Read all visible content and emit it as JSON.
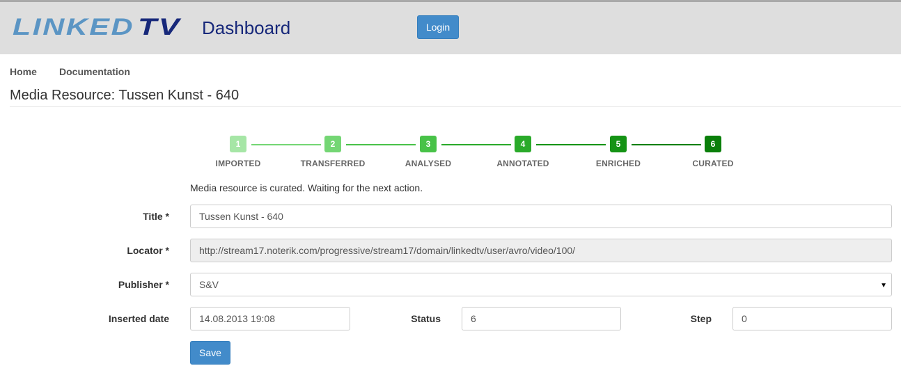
{
  "header": {
    "logo_text": "LINKEDTV",
    "title": "Dashboard",
    "login_label": "Login"
  },
  "nav": {
    "home": "Home",
    "documentation": "Documentation"
  },
  "page": {
    "title": "Media Resource: Tussen Kunst - 640"
  },
  "workflow": {
    "steps": [
      {
        "number": "1",
        "label": "IMPORTED",
        "color": "#a6e6a6"
      },
      {
        "number": "2",
        "label": "TRANSFERRED",
        "color": "#74d674"
      },
      {
        "number": "3",
        "label": "ANALYSED",
        "color": "#48c248"
      },
      {
        "number": "4",
        "label": "ANNOTATED",
        "color": "#2aaa2a"
      },
      {
        "number": "5",
        "label": "ENRICHED",
        "color": "#159315"
      },
      {
        "number": "6",
        "label": "CURATED",
        "color": "#0a7f0a"
      }
    ],
    "current_step": 6,
    "status_message": "Media resource is curated. Waiting for the next action."
  },
  "form": {
    "title_label": "Title *",
    "title_value": "Tussen Kunst - 640",
    "locator_label": "Locator *",
    "locator_value": "http://stream17.noterik.com/progressive/stream17/domain/linkedtv/user/avro/video/100/",
    "publisher_label": "Publisher *",
    "publisher_value": "S&V",
    "inserted_date_label": "Inserted date",
    "inserted_date_value": "14.08.2013 19:08",
    "status_label": "Status",
    "status_value": "6",
    "step_label": "Step",
    "step_value": "0",
    "save_label": "Save"
  },
  "colors": {
    "header_bg": "#dedede",
    "primary_button": "#428bca",
    "dashboard_title": "#17287a"
  }
}
